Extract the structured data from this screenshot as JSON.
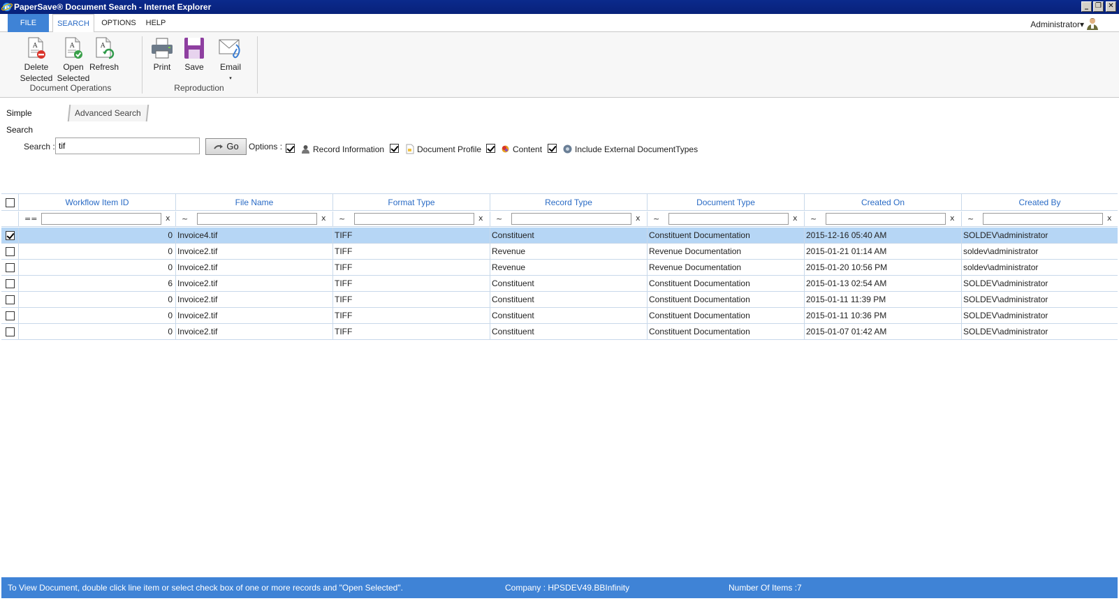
{
  "window": {
    "title": "PaperSave® Document Search - Internet Explorer",
    "minimize": "_",
    "restore": "❐",
    "close": "✕"
  },
  "menu": {
    "file": "FILE",
    "search": "SEARCH",
    "options": "OPTIONS",
    "help": "HELP",
    "user": "Administrator▾"
  },
  "ribbon": {
    "delete_line1": "Delete",
    "delete_line2": "Selected",
    "open_line1": "Open",
    "open_line2": "Selected",
    "refresh": "Refresh",
    "print": "Print",
    "save": "Save",
    "email": "Email",
    "email_caret": "▾",
    "group_document_operations": "Document Operations",
    "group_reproduction": "Reproduction"
  },
  "subtabs": {
    "simple": "Simple Search",
    "advanced": "Advanced Search"
  },
  "search": {
    "label": "Search :",
    "value": "tif",
    "go": "Go",
    "options_label": "Options :",
    "opt_record_information": "Record Information",
    "opt_document_profile": "Document Profile",
    "opt_content": "Content",
    "opt_include_external": "Include External DocumentTypes"
  },
  "grid": {
    "columns": [
      "Workflow Item ID",
      "File Name",
      "Format Type",
      "Record Type",
      "Document Type",
      "Created On",
      "Created By"
    ],
    "filter_ops": [
      "==",
      "~",
      "~",
      "~",
      "~",
      "~",
      "~"
    ],
    "filter_clear": "x",
    "rows": [
      {
        "checked": true,
        "id": "0",
        "file": "Invoice4.tif",
        "format": "TIFF",
        "record": "Constituent",
        "doctype": "Constituent Documentation",
        "created_on": "2015-12-16 05:40 AM",
        "created_by": "SOLDEV\\administrator"
      },
      {
        "checked": false,
        "id": "0",
        "file": "Invoice2.tif",
        "format": "TIFF",
        "record": "Revenue",
        "doctype": "Revenue Documentation",
        "created_on": "2015-01-21 01:14 AM",
        "created_by": "soldev\\administrator"
      },
      {
        "checked": false,
        "id": "0",
        "file": "Invoice2.tif",
        "format": "TIFF",
        "record": "Revenue",
        "doctype": "Revenue Documentation",
        "created_on": "2015-01-20 10:56 PM",
        "created_by": "soldev\\administrator"
      },
      {
        "checked": false,
        "id": "6",
        "file": "Invoice2.tif",
        "format": "TIFF",
        "record": "Constituent",
        "doctype": "Constituent Documentation",
        "created_on": "2015-01-13 02:54 AM",
        "created_by": "SOLDEV\\administrator"
      },
      {
        "checked": false,
        "id": "0",
        "file": "Invoice2.tif",
        "format": "TIFF",
        "record": "Constituent",
        "doctype": "Constituent Documentation",
        "created_on": "2015-01-11 11:39 PM",
        "created_by": "SOLDEV\\administrator"
      },
      {
        "checked": false,
        "id": "0",
        "file": "Invoice2.tif",
        "format": "TIFF",
        "record": "Constituent",
        "doctype": "Constituent Documentation",
        "created_on": "2015-01-11 10:36 PM",
        "created_by": "SOLDEV\\administrator"
      },
      {
        "checked": false,
        "id": "0",
        "file": "Invoice2.tif",
        "format": "TIFF",
        "record": "Constituent",
        "doctype": "Constituent Documentation",
        "created_on": "2015-01-07 01:42 AM",
        "created_by": "SOLDEV\\administrator"
      }
    ]
  },
  "status": {
    "hint": "To View Document, double click line item or select check box of one or more records and \"Open Selected\".",
    "company": "Company : HPSDEV49.BBInfinity",
    "count": "Number Of Items :7"
  },
  "colors": {
    "accent": "#3f83d6",
    "header_text": "#2a6bc5",
    "selected_row": "#b6d6f5",
    "titlebar": "#0b2a8c"
  }
}
